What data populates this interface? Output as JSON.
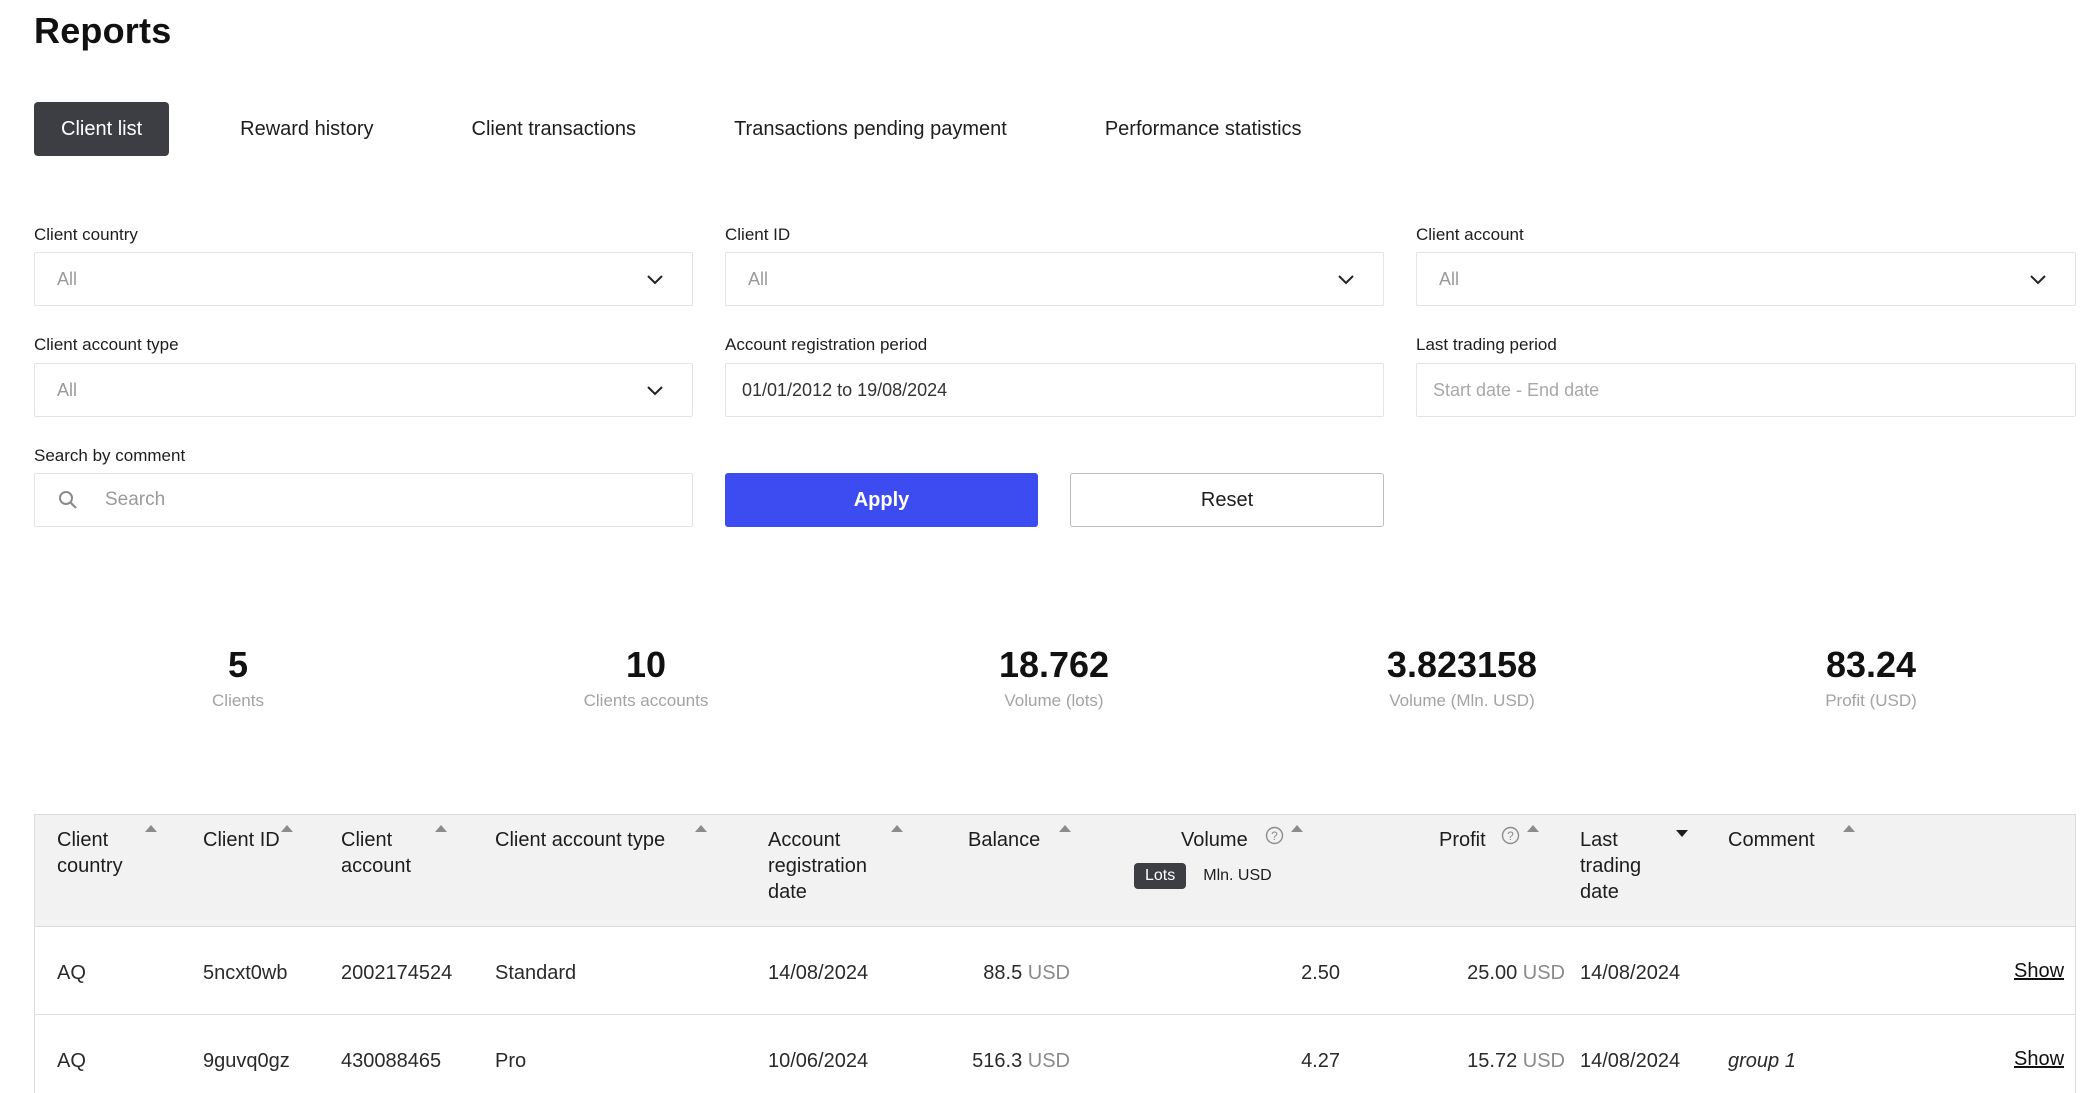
{
  "page": {
    "title": "Reports"
  },
  "tabs": [
    {
      "label": "Client list",
      "active": true
    },
    {
      "label": "Reward history",
      "active": false
    },
    {
      "label": "Client transactions",
      "active": false
    },
    {
      "label": "Transactions pending payment",
      "active": false
    },
    {
      "label": "Performance statistics",
      "active": false
    }
  ],
  "filters": {
    "client_country": {
      "label": "Client country",
      "value": "All"
    },
    "client_id": {
      "label": "Client ID",
      "value": "All"
    },
    "client_account": {
      "label": "Client account",
      "value": "All"
    },
    "client_account_type": {
      "label": "Client account type",
      "value": "All"
    },
    "registration_period": {
      "label": "Account registration period",
      "value": "01/01/2012 to 19/08/2024"
    },
    "last_trading_period": {
      "label": "Last trading period",
      "placeholder": "Start date - End date"
    },
    "search_comment": {
      "label": "Search by comment",
      "placeholder": "Search"
    },
    "apply_label": "Apply",
    "reset_label": "Reset"
  },
  "stats": [
    {
      "value": "5",
      "label": "Clients"
    },
    {
      "value": "10",
      "label": "Clients accounts"
    },
    {
      "value": "18.762",
      "label": "Volume (lots)"
    },
    {
      "value": "3.823158",
      "label": "Volume (Mln. USD)"
    },
    {
      "value": "83.24",
      "label": "Profit (USD)"
    }
  ],
  "table": {
    "headers": {
      "country": "Client country",
      "id": "Client ID",
      "account": "Client account",
      "type": "Client account type",
      "reg_date": "Account registration date",
      "balance": "Balance",
      "volume": "Volume",
      "profit": "Profit",
      "last_trading": "Last trading date",
      "comment": "Comment"
    },
    "volume_units": {
      "lots": "Lots",
      "mln": "Mln. USD",
      "active": "Lots"
    },
    "show_label": "Show",
    "rows": [
      {
        "country": "AQ",
        "id": "5ncxt0wb",
        "account": "2002174524",
        "type": "Standard",
        "reg_date": "14/08/2024",
        "balance": "88.5",
        "balance_cur": "USD",
        "volume": "2.50",
        "profit": "25.00",
        "profit_cur": "USD",
        "last_trading": "14/08/2024",
        "comment": ""
      },
      {
        "country": "AQ",
        "id": "9guvq0gz",
        "account": "430088465",
        "type": "Pro",
        "reg_date": "10/06/2024",
        "balance": "516.3",
        "balance_cur": "USD",
        "volume": "4.27",
        "profit": "15.72",
        "profit_cur": "USD",
        "last_trading": "14/08/2024",
        "comment": "group 1"
      }
    ]
  },
  "colors": {
    "accent": "#3d4cf0",
    "tab_active": "#3d3d44",
    "header_bg": "#f2f2f2"
  }
}
